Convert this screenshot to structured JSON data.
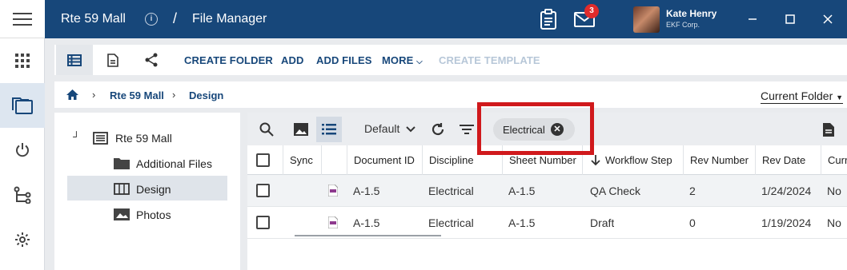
{
  "titlebar": {
    "project": "Rte 59 Mall",
    "separator": "/",
    "section": "File Manager",
    "notification_count": "3",
    "user_name": "Kate Henry",
    "user_org": "EKF Corp."
  },
  "toolbar": {
    "create_folder": "CREATE FOLDER",
    "add": "ADD",
    "add_files": "ADD FILES",
    "more": "MORE",
    "create_template": "CREATE TEMPLATE"
  },
  "breadcrumb": {
    "items": [
      "Rte 59 Mall",
      "Design"
    ],
    "current_folder": "Current Folder"
  },
  "tree": {
    "root": "Rte 59 Mall",
    "children": [
      "Additional Files",
      "Design",
      "Photos"
    ],
    "selected": "Design"
  },
  "grid": {
    "view": "Default",
    "filter_chip": "Electrical",
    "columns": [
      "Sync",
      "Document ID",
      "Discipline",
      "Sheet Number",
      "Workflow Step",
      "Rev Number",
      "Rev Date",
      "Curr"
    ],
    "rows": [
      {
        "doc_id": "A-1.5",
        "discipline": "Electrical",
        "sheet": "A-1.5",
        "step": "QA Check",
        "rev": "2",
        "date": "1/24/2024",
        "curr": "No"
      },
      {
        "doc_id": "A-1.5",
        "discipline": "Electrical",
        "sheet": "A-1.5",
        "step": "Draft",
        "rev": "0",
        "date": "1/19/2024",
        "curr": "No"
      }
    ]
  },
  "colors": {
    "brand": "#17477a",
    "highlight": "#d0191c",
    "badge": "#e02b2b"
  }
}
